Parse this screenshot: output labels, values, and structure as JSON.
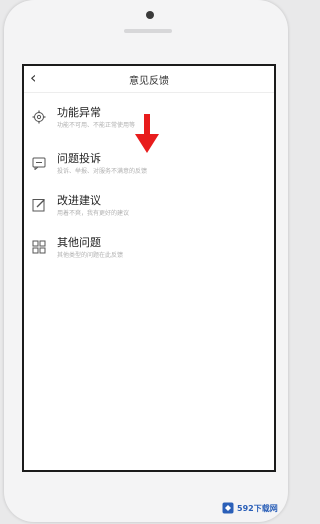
{
  "nav": {
    "back_icon": "‹",
    "title": "意见反馈"
  },
  "items": [
    {
      "icon": "gear-icon",
      "title": "功能异常",
      "desc": "功能不可用、不能正常使用等"
    },
    {
      "icon": "complaint-icon",
      "title": "问题投诉",
      "desc": "投诉、举报、对服务不满意的反馈"
    },
    {
      "icon": "edit-icon",
      "title": "改进建议",
      "desc": "用着不爽，我有更好的建议"
    },
    {
      "icon": "grid-icon",
      "title": "其他问题",
      "desc": "其他类型的问题在此反馈"
    }
  ],
  "watermark": {
    "text": "592下载网"
  },
  "colors": {
    "arrow": "#e81c1c",
    "watermark": "#2a5fb8"
  }
}
